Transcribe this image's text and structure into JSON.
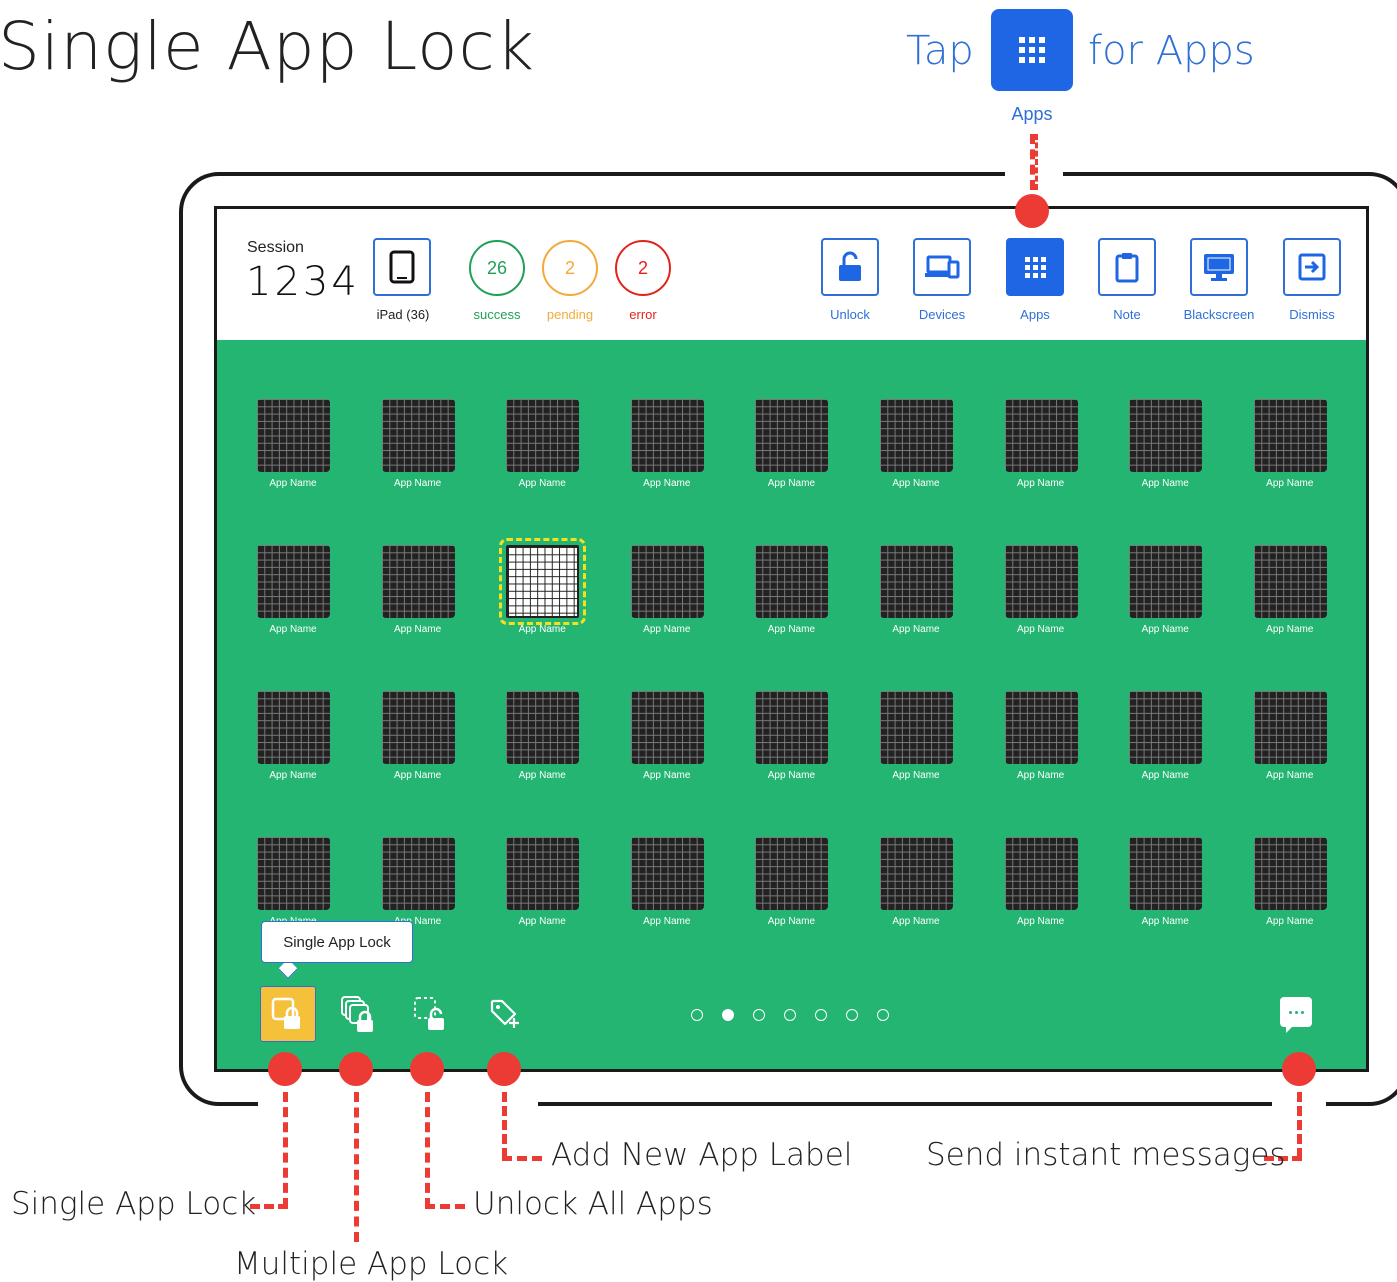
{
  "page": {
    "title": "Single App Lock"
  },
  "hint": {
    "tap": "Tap",
    "for_apps": "for Apps",
    "apps_label": "Apps",
    "icon": "apps-grid-icon"
  },
  "header": {
    "session_label": "Session",
    "session_number": "1234",
    "device_label": "iPad (36)",
    "device_icon": "ipad-icon",
    "stats": [
      {
        "value": "26",
        "label": "success",
        "color": "#21a058"
      },
      {
        "value": "2",
        "label": "pending",
        "color": "#f4a93a"
      },
      {
        "value": "2",
        "label": "error",
        "color": "#e2231a"
      }
    ],
    "tools": [
      {
        "label": "Unlock",
        "icon": "unlock-icon"
      },
      {
        "label": "Devices",
        "icon": "devices-icon"
      },
      {
        "label": "Apps",
        "icon": "apps-grid-icon"
      },
      {
        "label": "Note",
        "icon": "clipboard-icon"
      },
      {
        "label": "Blackscreen",
        "icon": "monitor-icon"
      },
      {
        "label": "Dismiss",
        "icon": "exit-icon"
      }
    ],
    "active_tool": "Apps"
  },
  "apps": {
    "rows": 4,
    "cols": 9,
    "name": "App Name",
    "selected_row": 2,
    "selected_col": 3
  },
  "tooltip": {
    "text": "Single App Lock"
  },
  "bottom_bar": {
    "buttons": [
      {
        "icon": "single-app-lock-icon",
        "active": true
      },
      {
        "icon": "multiple-app-lock-icon",
        "active": false
      },
      {
        "icon": "unlock-all-apps-icon",
        "active": false
      },
      {
        "icon": "add-app-label-icon",
        "active": false
      }
    ],
    "pages": 7,
    "current_page": 2,
    "message_icon": "chat-icon"
  },
  "callouts": {
    "single_app_lock": "Single App Lock",
    "multiple_app_lock": "Multiple App Lock",
    "unlock_all_apps": "Unlock All Apps",
    "add_new_app_label": "Add New App Label",
    "send_instant_messages": "Send instant messages"
  },
  "colors": {
    "accent": "#1f66e5",
    "screen": "#24b573",
    "callout": "#ec3b34",
    "highlight": "#f6c13a"
  }
}
